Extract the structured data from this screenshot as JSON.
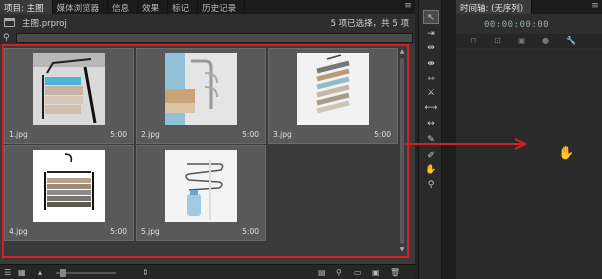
{
  "project_panel": {
    "tabs": [
      {
        "label": "项目: 主图",
        "active": true
      },
      {
        "label": "媒体浏览器",
        "active": false
      },
      {
        "label": "信息",
        "active": false
      },
      {
        "label": "效果",
        "active": false
      },
      {
        "label": "标记",
        "active": false
      },
      {
        "label": "历史记录",
        "active": false
      }
    ],
    "menu_icon": "≡",
    "project_name": "主图.prproj",
    "selection_status": "5 项已选择，共 5 项",
    "search": {
      "value": "",
      "placeholder": ""
    },
    "items": [
      {
        "name": "1.jpg",
        "duration": "5:00"
      },
      {
        "name": "2.jpg",
        "duration": "5:00"
      },
      {
        "name": "3.jpg",
        "duration": "5:00"
      },
      {
        "name": "4.jpg",
        "duration": "5:00"
      },
      {
        "name": "5.jpg",
        "duration": "5:00"
      }
    ],
    "highlight_color": "#d6201e"
  },
  "timeline_panel": {
    "tab_label": "时间轴: (无序列)",
    "menu_icon": "≡",
    "timecode": "00:00:00:00"
  },
  "arrow_color": "#d6201e"
}
